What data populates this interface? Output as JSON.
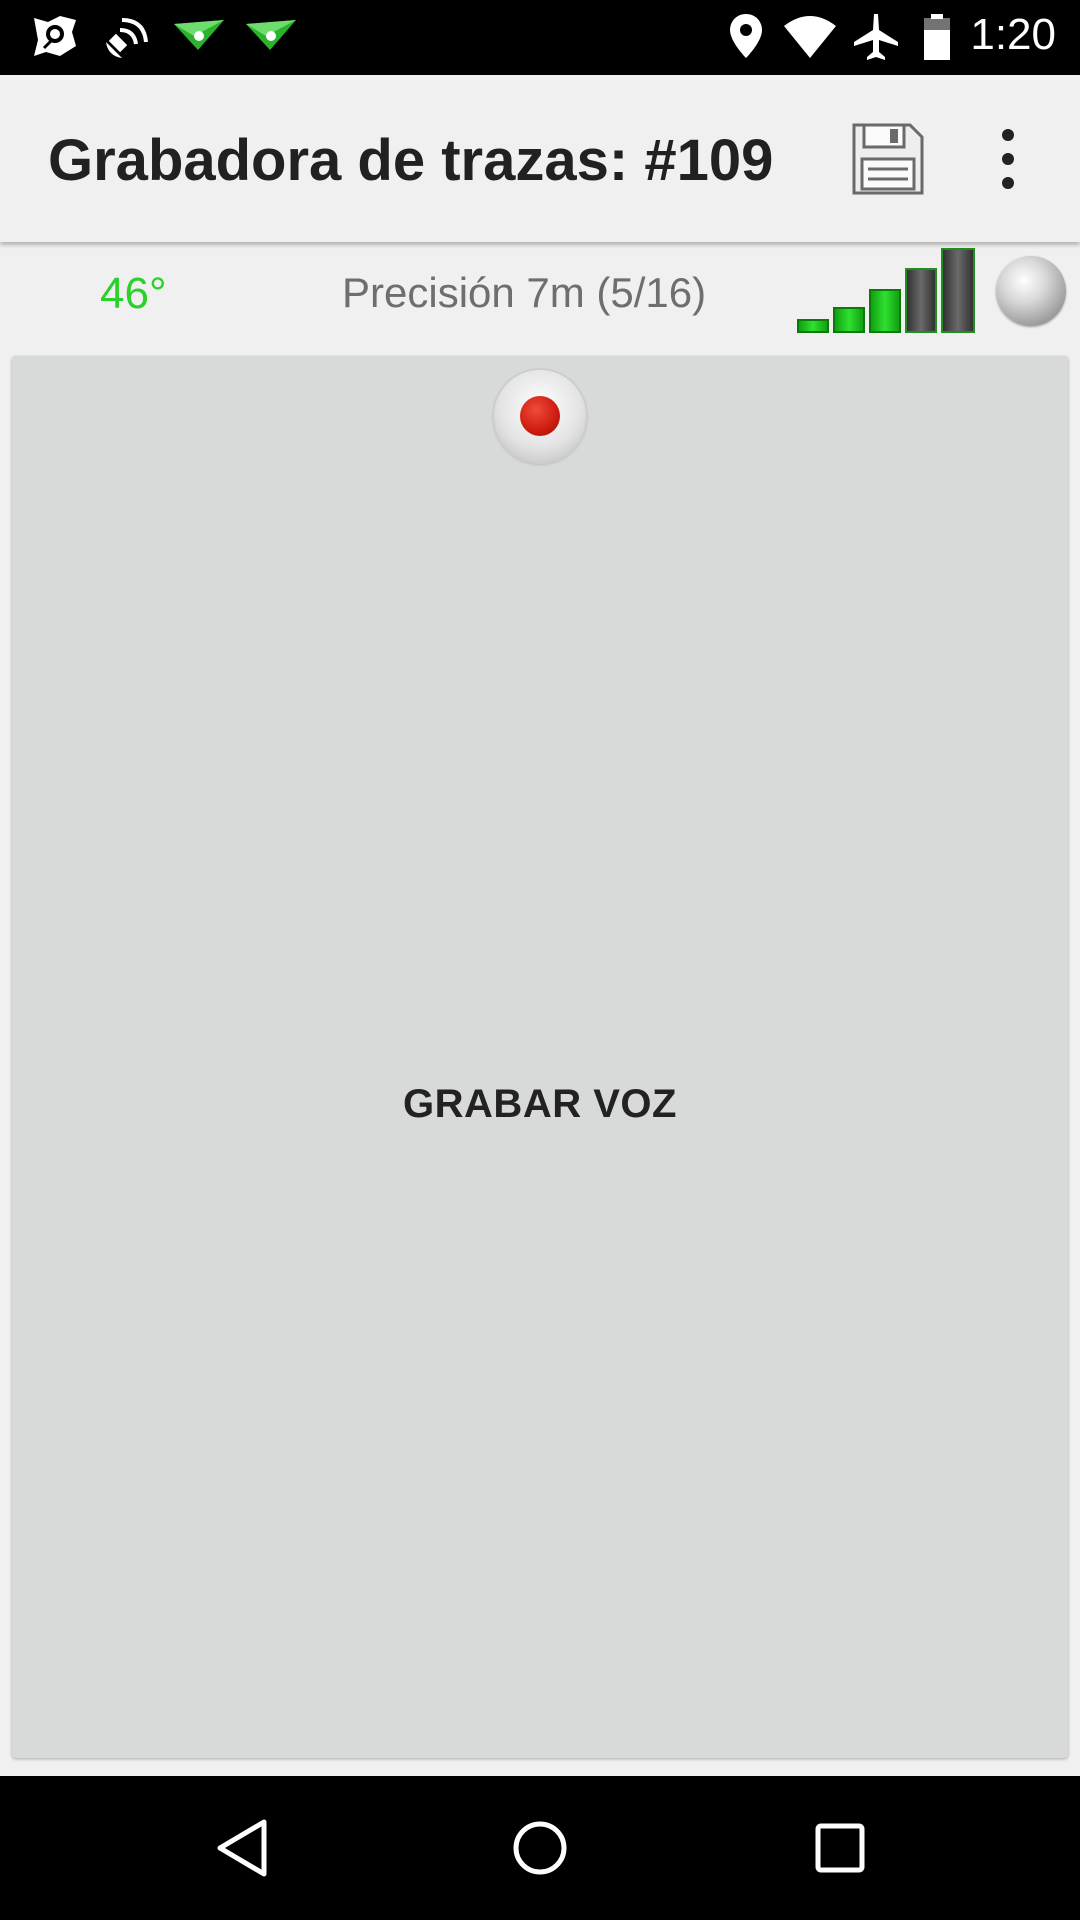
{
  "status_bar": {
    "time": "1:20",
    "left_icons": [
      "app-notification-icon",
      "satellite-icon",
      "paper-plane-icon",
      "paper-plane-icon"
    ],
    "right_icons": [
      "location-pin-icon",
      "wifi-icon",
      "airplane-icon",
      "battery-icon"
    ]
  },
  "app_bar": {
    "title": "Grabadora de trazas: #109",
    "actions": [
      "save-icon",
      "overflow-menu-icon"
    ]
  },
  "gps_info": {
    "heading": "46°",
    "heading_color": "#2ad12a",
    "precision": "Precisión 7m (5/16)",
    "signal_strength_bars": 5,
    "signal_active_bars": 3,
    "signal_active_color": "#1fc41f",
    "signal_inactive_color": "#4a4a4a"
  },
  "voice_panel": {
    "label": "GRABAR VOZ",
    "record_icon": "record-icon",
    "record_color": "#cc1c10"
  },
  "nav_bar": {
    "buttons": [
      "back-icon",
      "home-icon",
      "recents-icon"
    ]
  }
}
